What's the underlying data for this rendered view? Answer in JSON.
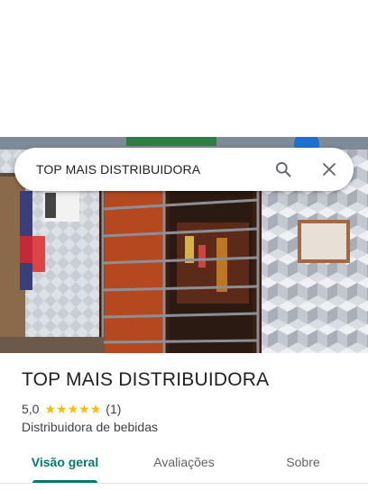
{
  "search": {
    "query": "TOP MAIS DISTRIBUIDORA"
  },
  "place": {
    "name": "TOP MAIS DISTRIBUIDORA",
    "rating": "5,0",
    "stars": 5,
    "review_count": "(1)",
    "category": "Distribuidora de bebidas"
  },
  "tabs": [
    {
      "label": "Visão geral",
      "active": true
    },
    {
      "label": "Avaliações",
      "active": false
    },
    {
      "label": "Sobre",
      "active": false
    }
  ],
  "colors": {
    "accent": "#01796f",
    "star": "#fbbc04"
  }
}
